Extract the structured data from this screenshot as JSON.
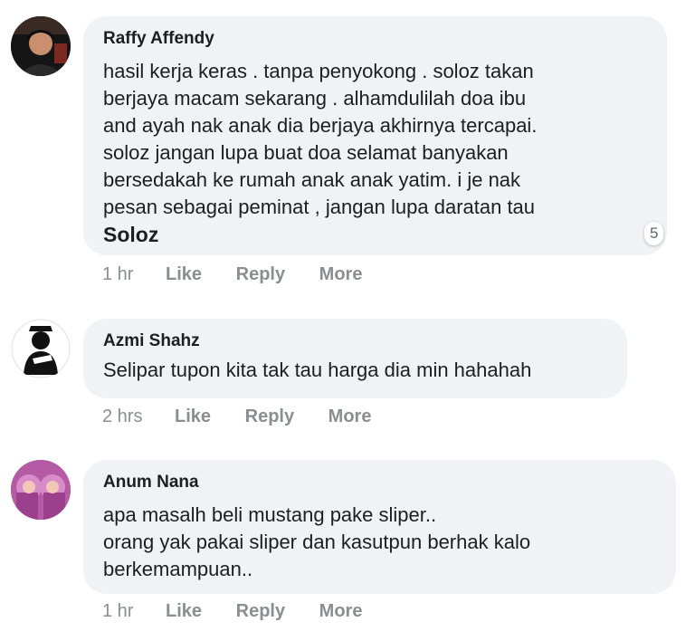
{
  "comments": [
    {
      "author": "Raffy Affendy",
      "text_lines": "hasil kerja keras . tanpa penyokong . soloz takan\nberjaya macam sekarang . alhamdulilah doa ibu\nand ayah nak anak dia berjaya akhirnya tercapai.\nsoloz jangan lupa buat doa selamat banyakan\nbersedakah ke rumah anak anak yatim. i je nak\npesan sebagai peminat , jangan lupa daratan tau",
      "tag": "Soloz",
      "reaction_count": "5",
      "time": "1 hr",
      "like": "Like",
      "reply": "Reply",
      "more": "More"
    },
    {
      "author": "Azmi Shahz",
      "text": "Selipar tupon kita tak tau harga dia min hahahah",
      "time": "2 hrs",
      "like": "Like",
      "reply": "Reply",
      "more": "More"
    },
    {
      "author": "Anum Nana",
      "text": "apa masalh beli mustang pake sliper..\norang yak pakai sliper dan kasutpun berhak kalo\nberkemampuan..",
      "time": "1 hr",
      "like": "Like",
      "reply": "Reply",
      "more": "More"
    }
  ]
}
